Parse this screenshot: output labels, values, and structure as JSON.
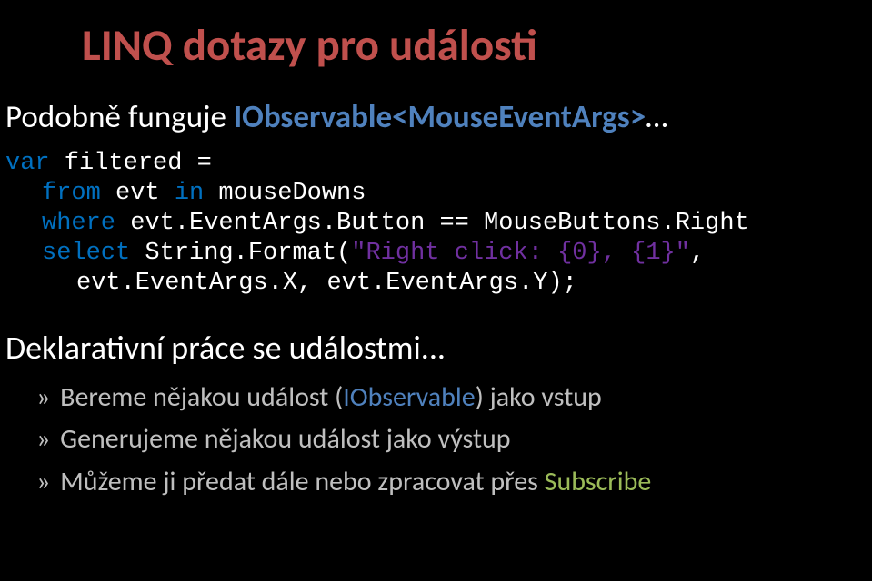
{
  "title": "LINQ dotazy pro události",
  "subtitle_prefix": "Podobně funguje ",
  "subtitle_highlight": "IObservable<MouseEventArgs>",
  "subtitle_suffix": "…",
  "code": {
    "line1": {
      "kw_var": "var",
      "rest": " filtered ="
    },
    "line2": {
      "kw_from": "from",
      "mid": " evt ",
      "kw_in": "in",
      "rest": " mouseDowns"
    },
    "line3": {
      "kw_where": "where",
      "rest": " evt.EventArgs.Button == MouseButtons.Right"
    },
    "line4": {
      "kw_select": "select",
      "mid": " String.Format(",
      "str": "\"Right click: {0}, {1}\"",
      "rest": ","
    },
    "line5": {
      "rest": "evt.EventArgs.X, evt.EventArgs.Y);"
    }
  },
  "section_heading": "Deklarativní práce se událostmi...",
  "bullet_marker": "»",
  "bullets": [
    {
      "pre": " Bereme nějakou událost (",
      "hl": "IObservable",
      "hl_class": "hl-blue",
      "post": ") jako vstup"
    },
    {
      "pre": " Generujeme nějakou událost jako výstup",
      "hl": "",
      "hl_class": "",
      "post": ""
    },
    {
      "pre": " Můžeme ji předat dále nebo zpracovat přes ",
      "hl": "Subscribe",
      "hl_class": "hl-green",
      "post": ""
    }
  ]
}
